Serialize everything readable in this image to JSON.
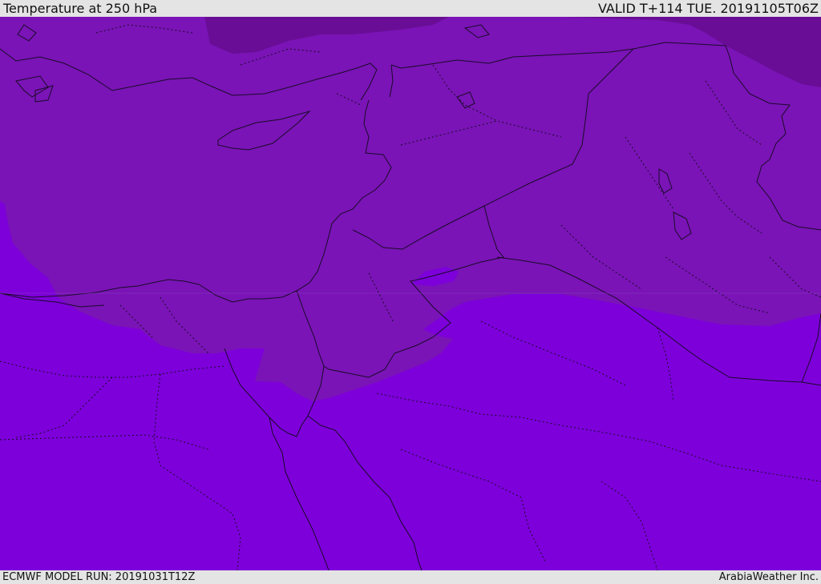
{
  "header": {
    "title": "Temperature at 250 hPa",
    "valid_time": "VALID T+114 TUE. 20191105T06Z"
  },
  "footer": {
    "model_run": "ECMWF MODEL RUN: 20191031T12Z",
    "credit": "ArabiaWeather Inc."
  },
  "map": {
    "colors": {
      "warm_band": "#7d00da",
      "mid_band": "#7a14b6",
      "cold_band": "#690d96",
      "border": "#1a0a28"
    }
  }
}
